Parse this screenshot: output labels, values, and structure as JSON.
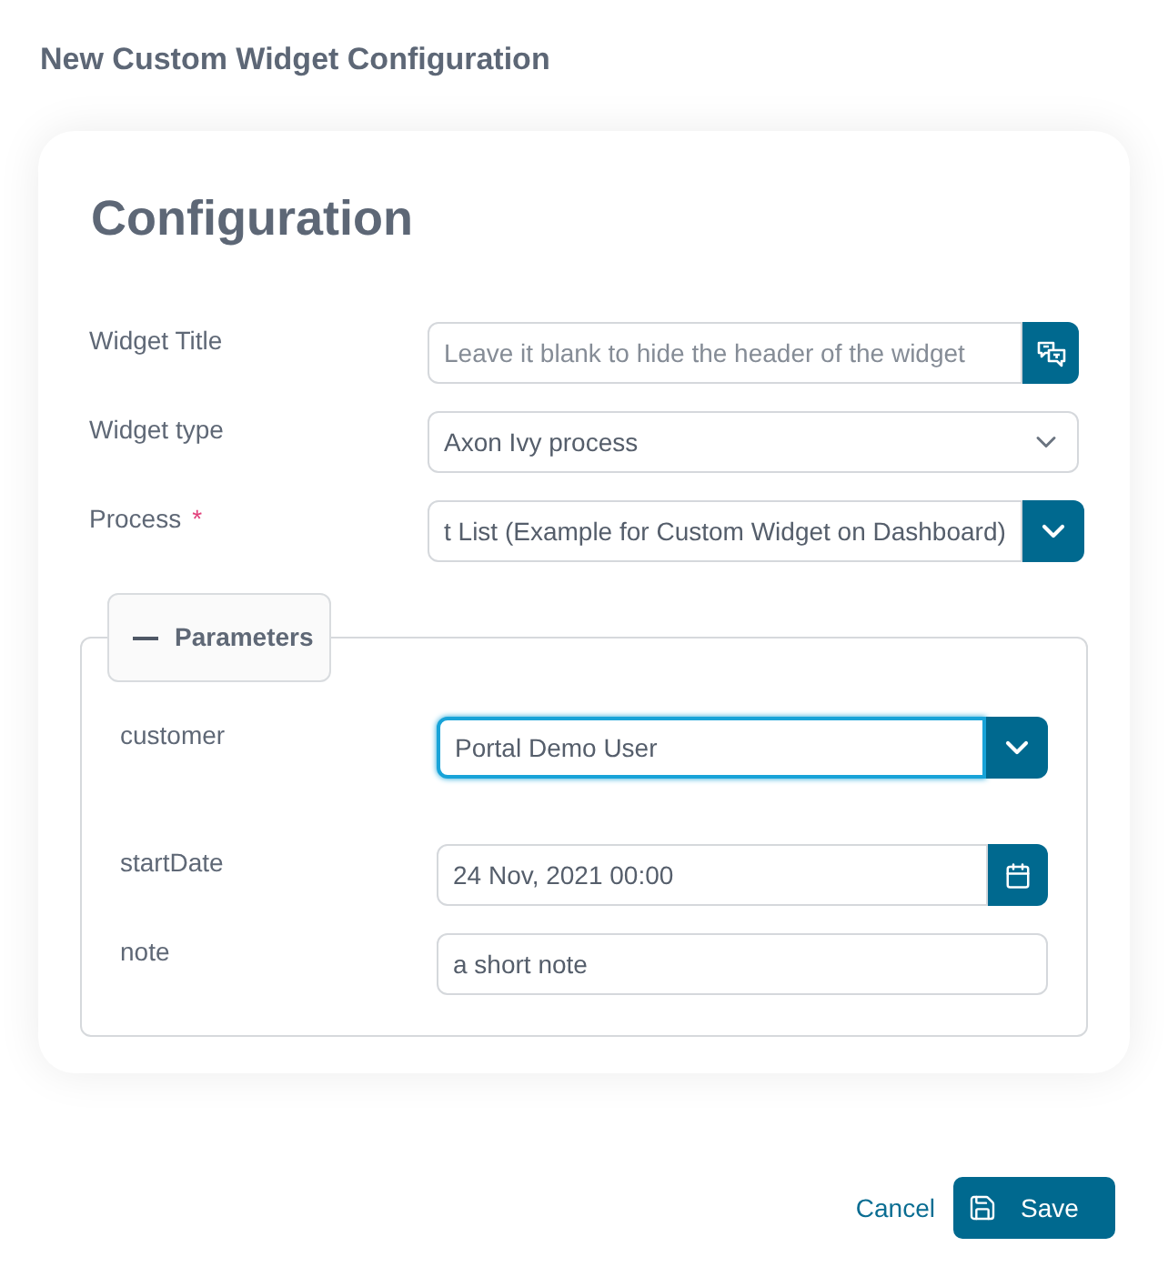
{
  "dialog": {
    "title": "New Custom Widget Configuration"
  },
  "card": {
    "heading": "Configuration"
  },
  "fields": [
    {
      "kind": "text_translate",
      "label": "Widget Title",
      "placeholder": "Leave it blank to hide the header of the widget",
      "focused": false
    },
    {
      "kind": "select",
      "label": "Widget type",
      "value": "Axon Ivy process",
      "focused": false
    },
    {
      "kind": "combo",
      "label": "Process",
      "required_mark": "*",
      "value": "t List (Example for Custom Widget on Dashboard)",
      "focused": false
    }
  ],
  "parameters": {
    "legend": "Parameters",
    "expanded": true,
    "fields": [
      {
        "kind": "combo",
        "label": "customer",
        "value": "Portal Demo User",
        "focused": true
      },
      {
        "kind": "date",
        "label": "startDate",
        "value": "24 Nov, 2021 00:00",
        "focused": false
      },
      {
        "kind": "text",
        "label": "note",
        "value": "a short note",
        "focused": false
      }
    ]
  },
  "footer": {
    "cancel": "Cancel",
    "save": "Save"
  }
}
